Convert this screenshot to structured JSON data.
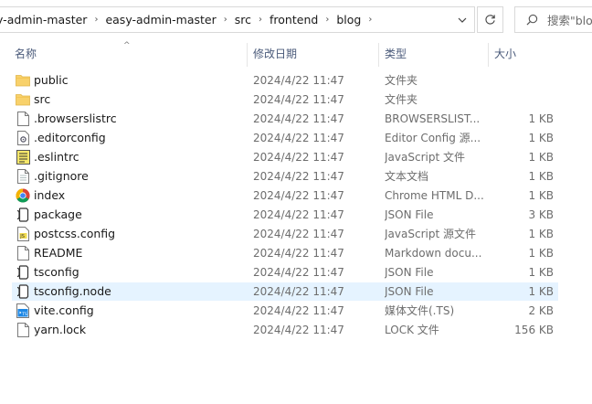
{
  "breadcrumb": {
    "items": [
      "y-admin-master",
      "easy-admin-master",
      "src",
      "frontend",
      "blog"
    ]
  },
  "search": {
    "placeholder": "搜索\"blog\""
  },
  "columns": {
    "name": "名称",
    "date": "修改日期",
    "type": "类型",
    "size": "大小"
  },
  "files": [
    {
      "name": "public",
      "date": "2024/4/22 11:47",
      "type": "文件夹",
      "size": "",
      "icon": "folder-icon"
    },
    {
      "name": "src",
      "date": "2024/4/22 11:47",
      "type": "文件夹",
      "size": "",
      "icon": "folder-icon"
    },
    {
      "name": ".browserslistrc",
      "date": "2024/4/22 11:47",
      "type": "BROWSERSLIST...",
      "size": "1 KB",
      "icon": "file-icon"
    },
    {
      "name": ".editorconfig",
      "date": "2024/4/22 11:47",
      "type": "Editor Config 源...",
      "size": "1 KB",
      "icon": "gear-file-icon"
    },
    {
      "name": ".eslintrc",
      "date": "2024/4/22 11:47",
      "type": "JavaScript 文件",
      "size": "1 KB",
      "icon": "script-file-icon"
    },
    {
      "name": ".gitignore",
      "date": "2024/4/22 11:47",
      "type": "文本文档",
      "size": "1 KB",
      "icon": "text-file-icon"
    },
    {
      "name": "index",
      "date": "2024/4/22 11:47",
      "type": "Chrome HTML D...",
      "size": "1 KB",
      "icon": "chrome-icon"
    },
    {
      "name": "package",
      "date": "2024/4/22 11:47",
      "type": "JSON File",
      "size": "3 KB",
      "icon": "json-file-icon"
    },
    {
      "name": "postcss.config",
      "date": "2024/4/22 11:47",
      "type": "JavaScript 源文件",
      "size": "1 KB",
      "icon": "js-file-icon"
    },
    {
      "name": "README",
      "date": "2024/4/22 11:47",
      "type": "Markdown docu...",
      "size": "1 KB",
      "icon": "file-icon"
    },
    {
      "name": "tsconfig",
      "date": "2024/4/22 11:47",
      "type": "JSON File",
      "size": "1 KB",
      "icon": "json-file-icon"
    },
    {
      "name": "tsconfig.node",
      "date": "2024/4/22 11:47",
      "type": "JSON File",
      "size": "1 KB",
      "icon": "json-file-icon"
    },
    {
      "name": "vite.config",
      "date": "2024/4/22 11:47",
      "type": "媒体文件(.TS)",
      "size": "2 KB",
      "icon": "ts-media-file-icon"
    },
    {
      "name": "yarn.lock",
      "date": "2024/4/22 11:47",
      "type": "LOCK 文件",
      "size": "156 KB",
      "icon": "file-icon"
    }
  ],
  "hovered_row": 11,
  "colors": {
    "folder": "#f8d16b",
    "selection": "#e5f3ff",
    "header_text": "#4a5a7a"
  }
}
